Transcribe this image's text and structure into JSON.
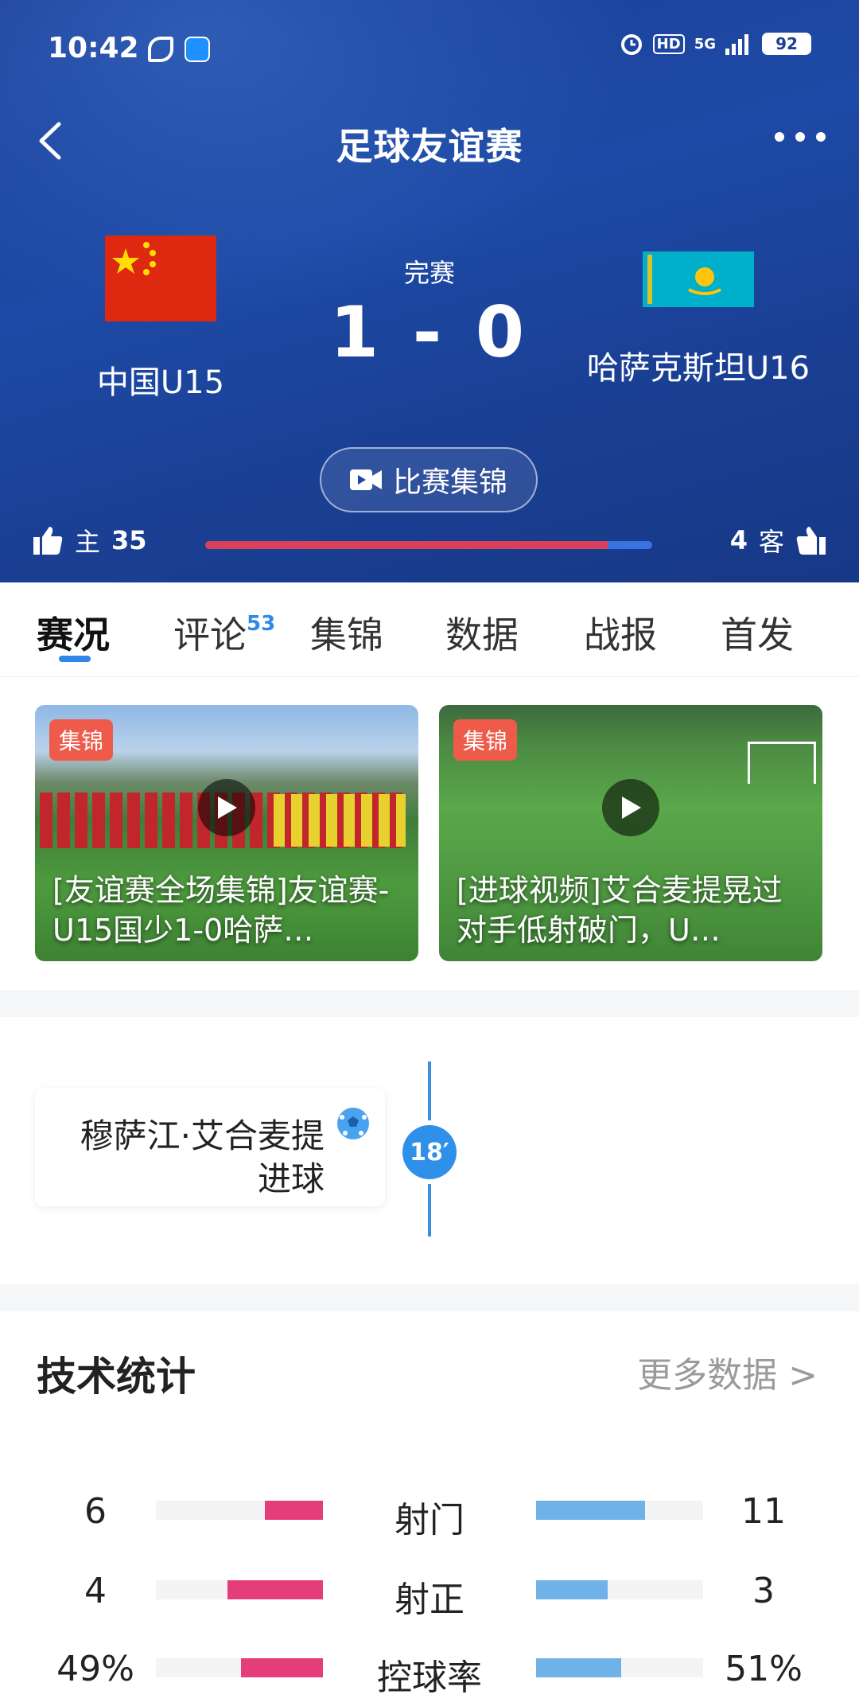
{
  "status_bar": {
    "time": "10:42",
    "hd": "HD",
    "network": "5G",
    "battery": "92"
  },
  "nav": {
    "title": "足球友谊赛"
  },
  "match": {
    "status": "完赛",
    "score": "1 - 0",
    "home_team": "中国U15",
    "away_team": "哈萨克斯坦U16",
    "highlights_button": "比赛集锦"
  },
  "likes": {
    "home_label": "主",
    "home_count": "35",
    "away_label": "客",
    "away_count": "4",
    "home_ratio": 0.9
  },
  "tabs": [
    {
      "label": "赛况",
      "badge": ""
    },
    {
      "label": "评论",
      "badge": "53"
    },
    {
      "label": "集锦",
      "badge": ""
    },
    {
      "label": "数据",
      "badge": ""
    },
    {
      "label": "战报",
      "badge": ""
    },
    {
      "label": "首发",
      "badge": ""
    }
  ],
  "videos": [
    {
      "tag": "集锦",
      "title": "[友谊赛全场集锦]友谊赛-U15国少1-0哈萨…"
    },
    {
      "tag": "集锦",
      "title": "[进球视频]艾合麦提晃过对手低射破门，U…"
    }
  ],
  "timeline": {
    "minute": "18′",
    "player": "穆萨江·艾合麦提",
    "event": "进球",
    "event_icon": "soccer-ball-icon"
  },
  "stats": {
    "title": "技术统计",
    "more": "更多数据 >",
    "rows": [
      {
        "home": "6",
        "label": "射门",
        "away": "11",
        "home_frac": 0.35,
        "away_frac": 0.65
      },
      {
        "home": "4",
        "label": "射正",
        "away": "3",
        "home_frac": 0.57,
        "away_frac": 0.43
      },
      {
        "home": "49%",
        "label": "控球率",
        "away": "51%",
        "home_frac": 0.49,
        "away_frac": 0.51
      }
    ]
  },
  "colors": {
    "header_blue": "#1d4aa6",
    "accent": "#2e88e8",
    "home_bar": "#e43d7a",
    "away_bar": "#6fb2e8",
    "tag_red": "#ef5b4a"
  }
}
